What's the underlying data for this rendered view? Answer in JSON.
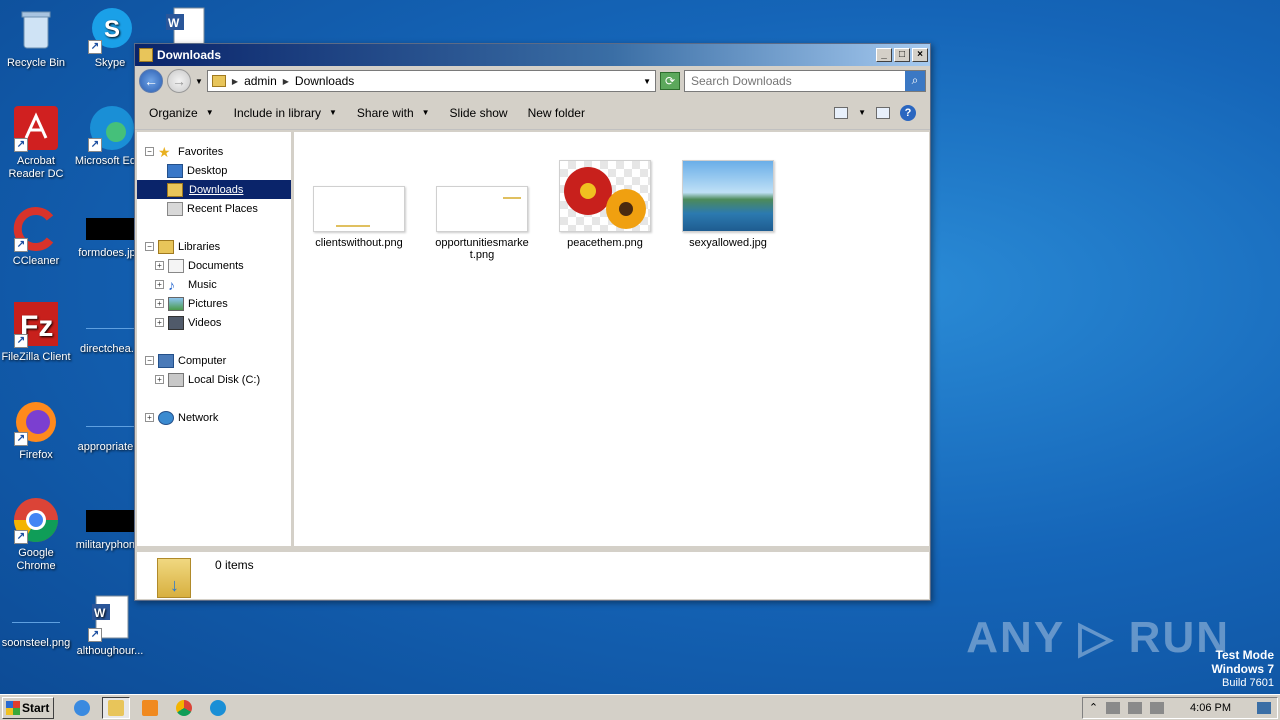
{
  "desktop": {
    "icons": [
      {
        "label": "Recycle Bin"
      },
      {
        "label": "Skype"
      },
      {
        "label": "Acrobat Reader DC"
      },
      {
        "label": "Microsoft Ed..."
      },
      {
        "label": "CCleaner"
      },
      {
        "label": "formdoes.jpg"
      },
      {
        "label": "FileZilla Client"
      },
      {
        "label": "directchea..."
      },
      {
        "label": "Firefox"
      },
      {
        "label": "appropriate..."
      },
      {
        "label": "Google Chrome"
      },
      {
        "label": "militaryphon..."
      },
      {
        "label": "soonsteel.png"
      },
      {
        "label": "althoughour..."
      }
    ]
  },
  "window": {
    "title": "Downloads",
    "address": {
      "crumbs": [
        "admin",
        "Downloads"
      ]
    },
    "search": {
      "placeholder": "Search Downloads"
    },
    "toolbar": {
      "organize": "Organize",
      "include": "Include in library",
      "share": "Share with",
      "slideshow": "Slide show",
      "newfolder": "New folder"
    },
    "nav": {
      "favorites": "Favorites",
      "desktop": "Desktop",
      "downloads": "Downloads",
      "recent": "Recent Places",
      "libraries": "Libraries",
      "documents": "Documents",
      "music": "Music",
      "pictures": "Pictures",
      "videos": "Videos",
      "computer": "Computer",
      "localdisk": "Local Disk (C:)",
      "network": "Network"
    },
    "files": [
      {
        "name": "clientswithout.png"
      },
      {
        "name": "opportunitiesmarket.png"
      },
      {
        "name": "peacethem.png"
      },
      {
        "name": "sexyallowed.jpg"
      }
    ],
    "status": {
      "items": "0 items"
    }
  },
  "watermark": "ANY ▷ RUN",
  "testmode": {
    "line1": "Test Mode",
    "line2": "Windows 7",
    "line3": "Build 7601"
  },
  "taskbar": {
    "start": "Start",
    "clock": "4:06 PM"
  }
}
